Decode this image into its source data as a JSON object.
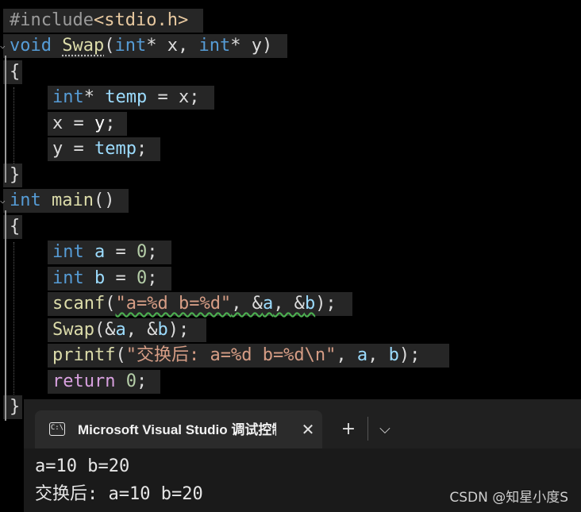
{
  "code": {
    "line1": {
      "hash": "#include",
      "lt": "<",
      "hdr": "stdio.h",
      "gt": ">"
    },
    "line2": {
      "kw": "void",
      "sp": " ",
      "fn": "Swap",
      "rest1": "(",
      "t1": "int",
      "rest2": "* x, ",
      "t2": "int",
      "rest3": "* y)"
    },
    "line3": {
      "brace": "{"
    },
    "line4": {
      "kw": "int",
      "rest1": "* ",
      "v": "temp",
      "rest2": " = x;"
    },
    "line5": {
      "a": "x = ",
      "v": "y",
      "b": ";"
    },
    "line6": {
      "a": "y = ",
      "v": "temp",
      "b": ";"
    },
    "line7": {
      "brace": "}"
    },
    "line8": {
      "kw": "int",
      "sp": " ",
      "fn": "main",
      "rest": "()"
    },
    "line9": {
      "brace": "{"
    },
    "line10": {
      "kw": "int",
      "sp": " ",
      "v": "a",
      "rest": " = ",
      "num": "0",
      "end": ";"
    },
    "line11": {
      "kw": "int",
      "sp": " ",
      "v": "b",
      "rest": " = ",
      "num": "0",
      "end": ";"
    },
    "line12": {
      "fn": "scanf",
      "p1": "(",
      "str": "\"a=%d b=%d\"",
      "p2": ", &",
      "va": "a",
      "p3": ", &",
      "vb": "b",
      "p4": ");"
    },
    "line13": {
      "fn": "Swap",
      "p1": "(&",
      "va": "a",
      "p2": ", &",
      "vb": "b",
      "p3": ");"
    },
    "line14": {
      "fn": "printf",
      "p1": "(",
      "str": "\"交换后: a=%d b=%d\\n\"",
      "p2": ", ",
      "va": "a",
      "p3": ", ",
      "vb": "b",
      "p4": ");"
    },
    "line15": {
      "kw": "return",
      "sp": " ",
      "num": "0",
      "end": ";"
    },
    "line16": {
      "brace": "}"
    }
  },
  "terminal": {
    "tab_title": "Microsoft Visual Studio 调试控制台",
    "tab_icon_text": "C:\\",
    "close_label": "✕",
    "add_label": "+",
    "dropdown_label": "⌵",
    "output": [
      "a=10 b=20",
      "交换后: a=10 b=20"
    ]
  },
  "watermark": "CSDN @知星小度S",
  "icons": {
    "fold": "chevron-down-icon",
    "close": "close-icon",
    "add": "plus-icon",
    "dropdown": "chevron-down-icon",
    "console": "console-icon"
  }
}
